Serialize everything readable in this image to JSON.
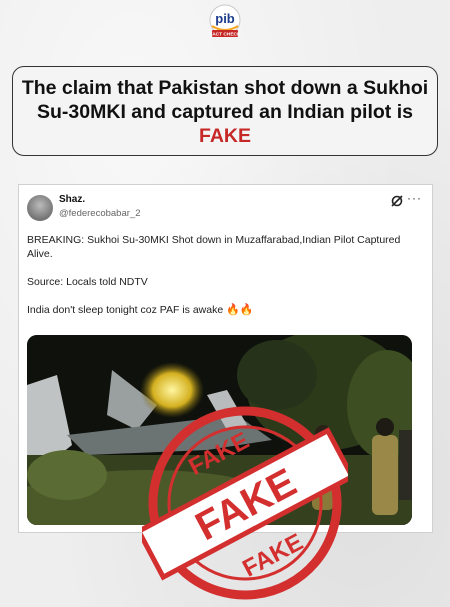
{
  "logo": {
    "text": "pib",
    "subtext": "FACT CHECK",
    "accent": "#c62828"
  },
  "headline": {
    "line": "The claim that Pakistan shot down a Sukhoi Su-30MKI and captured an Indian pilot is",
    "verdict": "FAKE",
    "verdict_color": "#c62828"
  },
  "tweet": {
    "name": "Shaz.",
    "handle": "@federecobabar_2",
    "paragraphs": [
      "BREAKING: Sukhoi Su-30MKI Shot down in Muzaffarabad,Indian Pilot Captured Alive.",
      "Source: Locals told NDTV",
      "India don't sleep tonight coz PAF is awake"
    ],
    "emoji": "🔥🔥",
    "icons": [
      "grok-icon",
      "more-icon"
    ]
  },
  "stamp": {
    "text": "FAKE",
    "color": "#d32f2f"
  }
}
